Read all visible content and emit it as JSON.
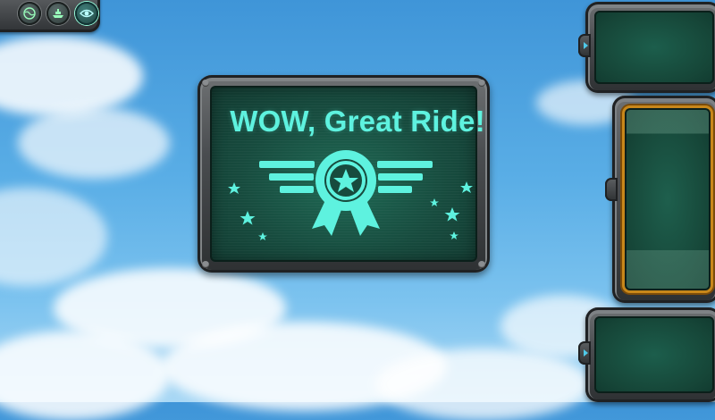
{
  "toolbar": {
    "buttons": [
      {
        "icon": "globe-icon",
        "active": false
      },
      {
        "icon": "ship-icon",
        "active": false
      },
      {
        "icon": "eye-icon",
        "active": true
      }
    ]
  },
  "award": {
    "headline": "WOW, Great Ride!",
    "badge_icon": "star-medal-icon"
  },
  "side_slots": [
    {
      "name": "slot-top",
      "selected": false
    },
    {
      "name": "slot-middle",
      "selected": true
    },
    {
      "name": "slot-bottom",
      "selected": false
    }
  ],
  "colors": {
    "accent": "#5ef2df",
    "screen": "#174b3e",
    "frame": "#4a4d50",
    "selected_border": "#c8871a"
  }
}
